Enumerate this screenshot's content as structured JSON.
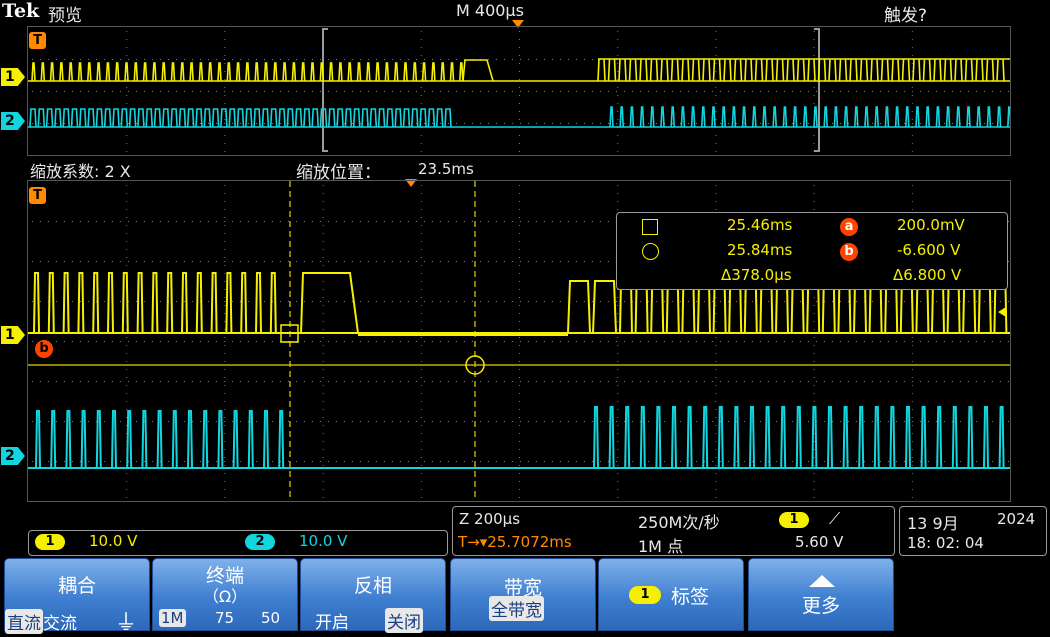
{
  "header": {
    "brand": "Tek",
    "mode": "预览",
    "timebase": "M 400µs",
    "trigger_status": "触发?"
  },
  "overview": {
    "trigger_marker": "T",
    "ch1_marker": "1",
    "ch2_marker": "2"
  },
  "zoom_info": {
    "factor": "缩放系数: 2 X",
    "position_label": "缩放位置：",
    "position_value": "23.5ms"
  },
  "main": {
    "trigger_marker": "T",
    "ch1_marker": "1",
    "ch2_marker": "2",
    "cursor_b_marker": "b"
  },
  "cursors": {
    "row1": {
      "icon": "square-cursor-icon",
      "time": "25.46ms",
      "label": "a",
      "voltage": "200.0mV"
    },
    "row2": {
      "icon": "circle-cursor-icon",
      "time": "25.84ms",
      "label": "b",
      "voltage": "-6.600 V"
    },
    "delta": {
      "time": "Δ378.0µs",
      "voltage": "Δ6.800 V"
    }
  },
  "channels": {
    "ch1": {
      "num": "1",
      "scale": "10.0 V"
    },
    "ch2": {
      "num": "2",
      "scale": "10.0 V"
    }
  },
  "acquisition": {
    "zoom_scale": "Z 200µs",
    "sample_rate": "250M次/秒",
    "trigger_position": "T→▾25.7072ms",
    "record_length": "1M 点",
    "trigger_channel": "1",
    "trigger_slope": "⟋",
    "trigger_level": "5.60 V"
  },
  "datetime": {
    "date": "13 9月",
    "year": "2024",
    "time": "18: 02: 04"
  },
  "menu": {
    "coupling": {
      "title": "耦合",
      "opt1": "直流",
      "opt2": "交流",
      "opt3": "⏚"
    },
    "termination": {
      "title": "终端",
      "unit": "（Ω）",
      "opt1": "1M",
      "opt2": "75",
      "opt3": "50"
    },
    "invert": {
      "title": "反相",
      "opt_on": "开启",
      "opt_off": "关闭"
    },
    "bandwidth": {
      "title": "带宽",
      "value": "全带宽"
    },
    "label": {
      "num": "1",
      "title": "标签"
    },
    "more": {
      "title": "更多"
    }
  },
  "colors": {
    "ch1": "#f5f000",
    "ch2": "#11d6e0",
    "trigger": "#ff8a00",
    "cursor_label": "#ff4400",
    "button": "#3f7fd0"
  }
}
